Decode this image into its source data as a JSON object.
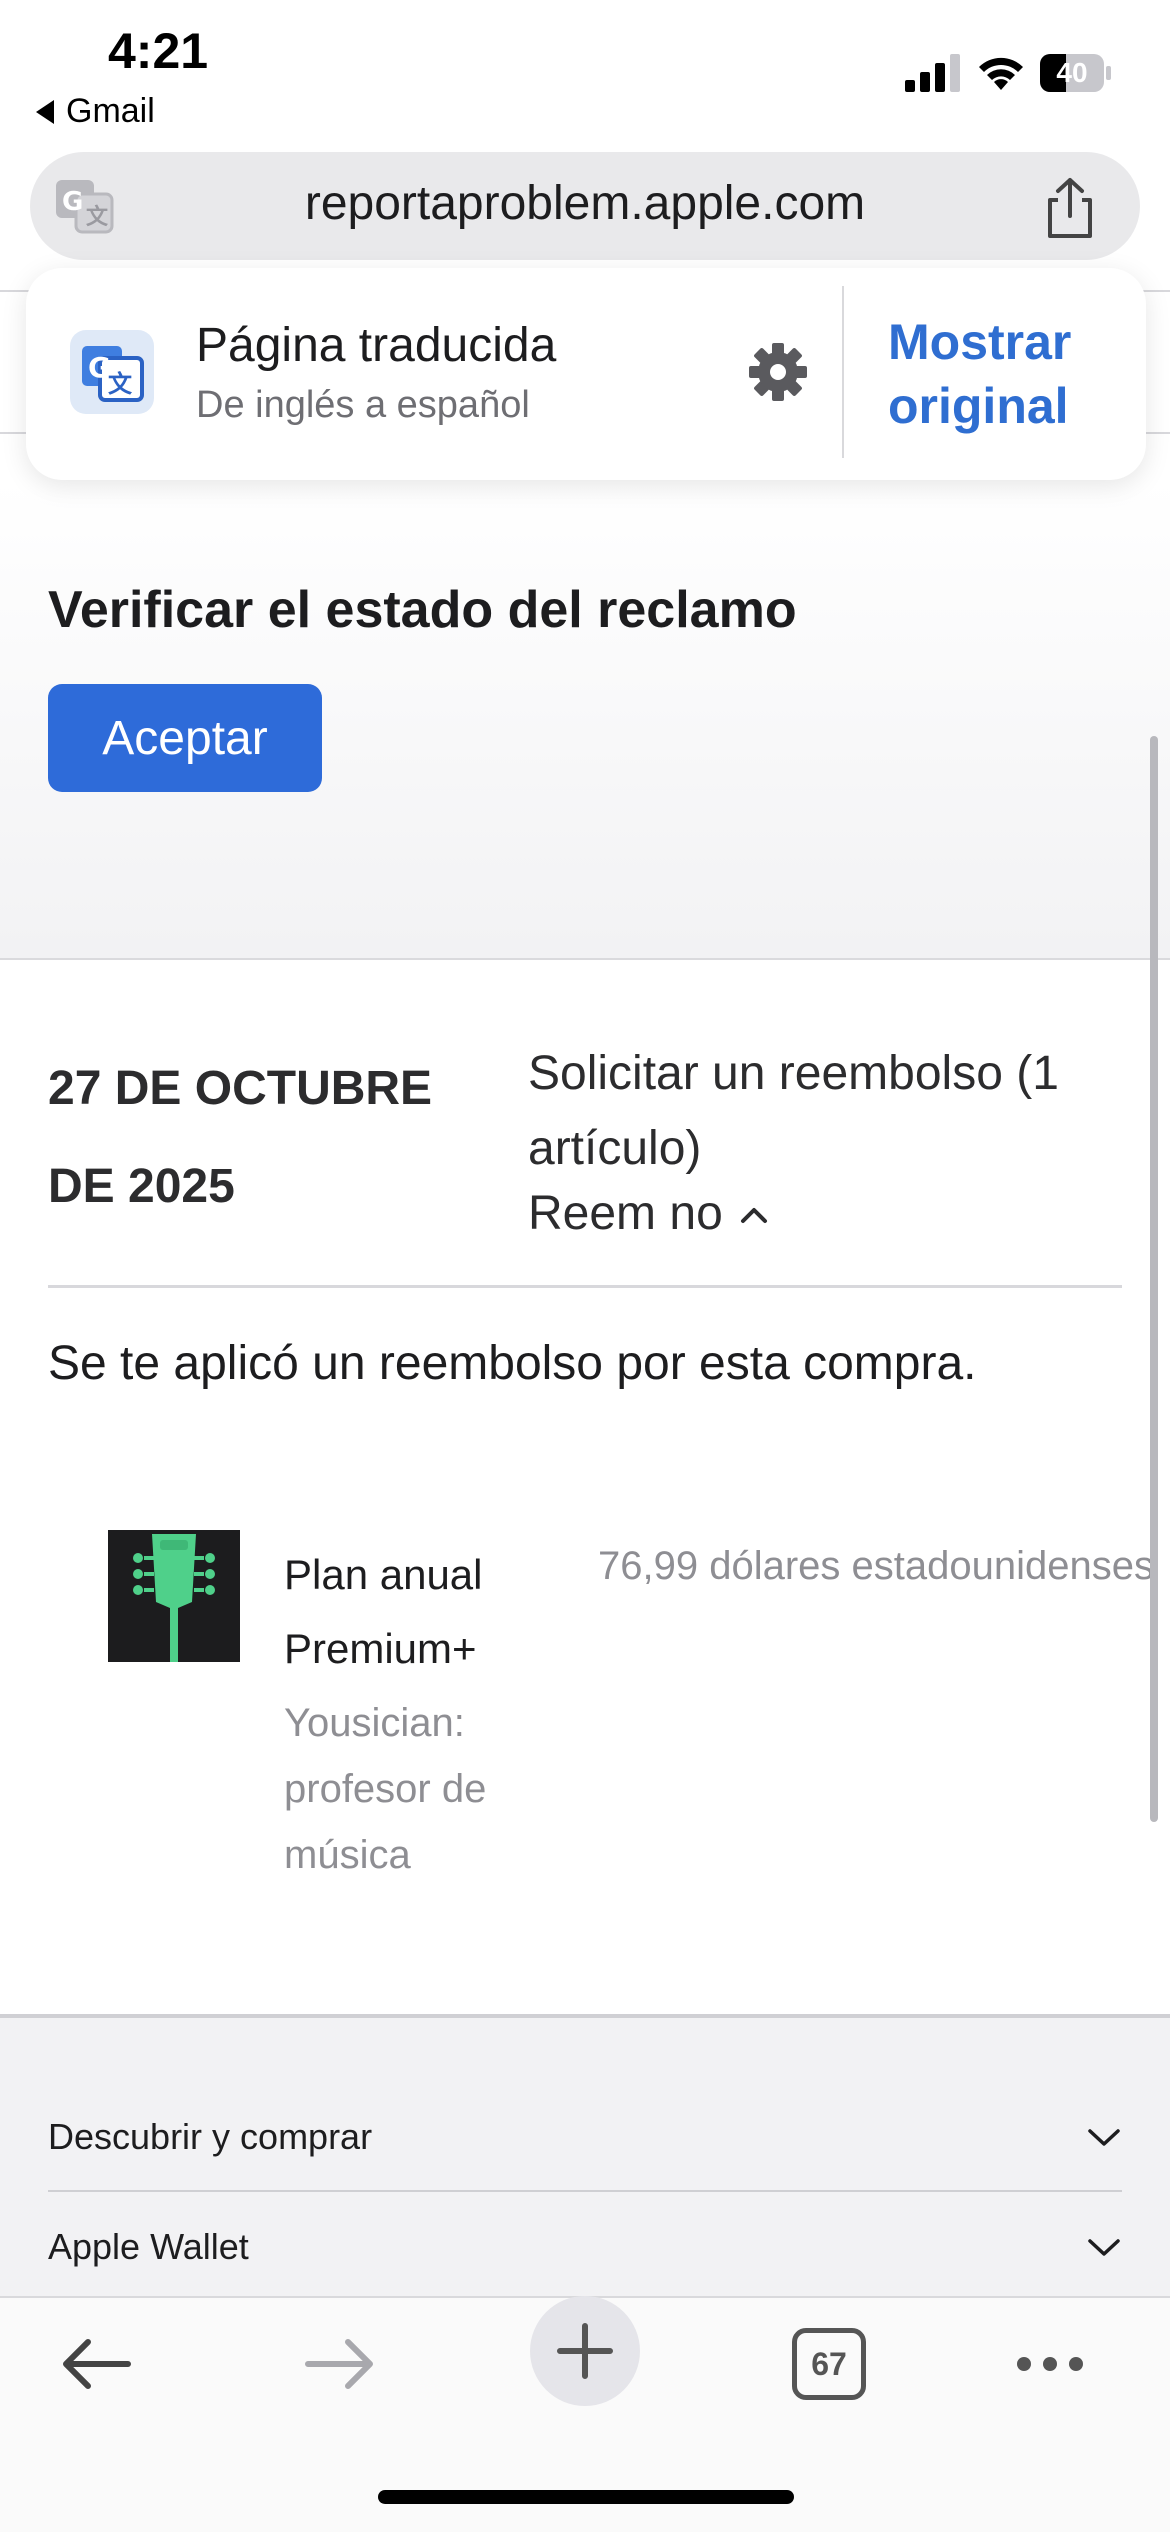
{
  "status_bar": {
    "time": "4:21",
    "back_app": "Gmail",
    "battery": "40",
    "battery_level": 0.4
  },
  "browser": {
    "url": "reportaproblem.apple.com",
    "tab_count": "67"
  },
  "translate_popup": {
    "title": "Página traducida",
    "subtitle": "De inglés a español",
    "show_original": "Mostrar original"
  },
  "claim": {
    "title": "Verificar el estado del reclamo",
    "accept_label": "Aceptar"
  },
  "order": {
    "date": "27 DE OCTUBRE DE 2025",
    "description": "Solicitar un reembolso (1 artículo)",
    "refund_toggle": "Reem no",
    "refund_message": "Se te aplicó un reembolso por esta compra."
  },
  "item": {
    "name": "Plan anual Premium+",
    "app": "Yousician: profesor de música",
    "price": "76,99 dólares estadounidenses"
  },
  "footer": {
    "items": [
      {
        "label": "Descubrir y comprar"
      },
      {
        "label": "Apple Wallet"
      }
    ]
  },
  "colors": {
    "accent": "#2e6bd9",
    "link": "#2f6ed1",
    "app_icon_green": "#4fd08a"
  }
}
